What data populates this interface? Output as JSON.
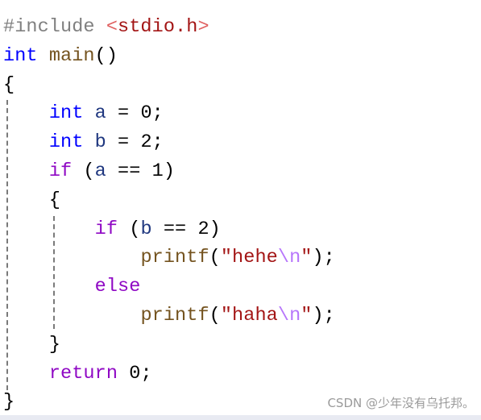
{
  "editor": {
    "lines": [
      {
        "tokens": [
          {
            "t": "#include ",
            "c": "pp"
          },
          {
            "t": "<",
            "c": "ang"
          },
          {
            "t": "stdio.h",
            "c": "hdr"
          },
          {
            "t": ">",
            "c": "ang"
          }
        ]
      },
      {
        "tokens": [
          {
            "t": "int",
            "c": "kw-type"
          },
          {
            "t": " ",
            "c": "punct"
          },
          {
            "t": "main",
            "c": "func"
          },
          {
            "t": "()",
            "c": "punct"
          }
        ]
      },
      {
        "tokens": [
          {
            "t": "{",
            "c": "punct"
          }
        ]
      },
      {
        "tokens": [
          {
            "t": "    ",
            "c": "punct"
          },
          {
            "t": "int",
            "c": "kw-type"
          },
          {
            "t": " ",
            "c": "punct"
          },
          {
            "t": "a",
            "c": "ident"
          },
          {
            "t": " = ",
            "c": "punct"
          },
          {
            "t": "0",
            "c": "num"
          },
          {
            "t": ";",
            "c": "punct"
          }
        ]
      },
      {
        "tokens": [
          {
            "t": "    ",
            "c": "punct"
          },
          {
            "t": "int",
            "c": "kw-type"
          },
          {
            "t": " ",
            "c": "punct"
          },
          {
            "t": "b",
            "c": "ident"
          },
          {
            "t": " = ",
            "c": "punct"
          },
          {
            "t": "2",
            "c": "num"
          },
          {
            "t": ";",
            "c": "punct"
          }
        ]
      },
      {
        "tokens": [
          {
            "t": "    ",
            "c": "punct"
          },
          {
            "t": "if",
            "c": "kw-ctrl"
          },
          {
            "t": " (",
            "c": "punct"
          },
          {
            "t": "a",
            "c": "ident"
          },
          {
            "t": " == ",
            "c": "punct"
          },
          {
            "t": "1",
            "c": "num"
          },
          {
            "t": ")",
            "c": "punct"
          }
        ]
      },
      {
        "tokens": [
          {
            "t": "    ",
            "c": "punct"
          },
          {
            "t": "{",
            "c": "punct"
          }
        ]
      },
      {
        "tokens": [
          {
            "t": "        ",
            "c": "punct"
          },
          {
            "t": "if",
            "c": "kw-ctrl"
          },
          {
            "t": " (",
            "c": "punct"
          },
          {
            "t": "b",
            "c": "ident"
          },
          {
            "t": " == ",
            "c": "punct"
          },
          {
            "t": "2",
            "c": "num"
          },
          {
            "t": ")",
            "c": "punct"
          }
        ]
      },
      {
        "tokens": [
          {
            "t": "            ",
            "c": "punct"
          },
          {
            "t": "printf",
            "c": "func"
          },
          {
            "t": "(",
            "c": "punct"
          },
          {
            "t": "\"hehe",
            "c": "str"
          },
          {
            "t": "\\n",
            "c": "esc"
          },
          {
            "t": "\"",
            "c": "str"
          },
          {
            "t": ");",
            "c": "punct"
          }
        ]
      },
      {
        "tokens": [
          {
            "t": "        ",
            "c": "punct"
          },
          {
            "t": "else",
            "c": "kw-ctrl"
          }
        ]
      },
      {
        "tokens": [
          {
            "t": "            ",
            "c": "punct"
          },
          {
            "t": "printf",
            "c": "func"
          },
          {
            "t": "(",
            "c": "punct"
          },
          {
            "t": "\"haha",
            "c": "str"
          },
          {
            "t": "\\n",
            "c": "esc"
          },
          {
            "t": "\"",
            "c": "str"
          },
          {
            "t": ");",
            "c": "punct"
          }
        ]
      },
      {
        "tokens": [
          {
            "t": "    ",
            "c": "punct"
          },
          {
            "t": "}",
            "c": "punct"
          }
        ]
      },
      {
        "tokens": [
          {
            "t": "    ",
            "c": "punct"
          },
          {
            "t": "return",
            "c": "kw-ctrl"
          },
          {
            "t": " ",
            "c": "punct"
          },
          {
            "t": "0",
            "c": "num"
          },
          {
            "t": ";",
            "c": "punct"
          }
        ]
      },
      {
        "tokens": [
          {
            "t": "}",
            "c": "punct"
          }
        ]
      }
    ]
  },
  "watermark": "CSDN @少年没有乌托邦。"
}
